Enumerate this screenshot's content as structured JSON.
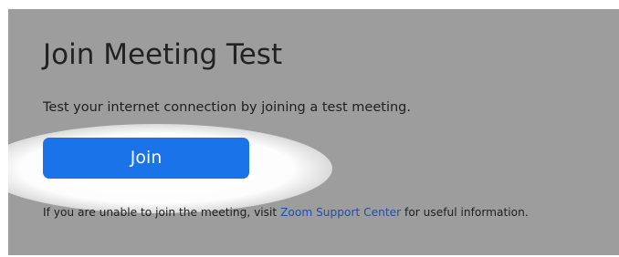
{
  "page": {
    "title": "Join Meeting Test",
    "description": "Test your internet connection by joining a test meeting.",
    "join_button_label": "Join",
    "note": {
      "before_link": "If you are unable to join the meeting, visit",
      "link_text": "Zoom Support Center",
      "after_link": "for useful information."
    }
  },
  "colors": {
    "panel_background": "#9d9d9d",
    "button_background": "#1a73e8",
    "button_text": "#ffffff",
    "link": "#1f4fa6",
    "highlight_glow": "#ffffff"
  }
}
